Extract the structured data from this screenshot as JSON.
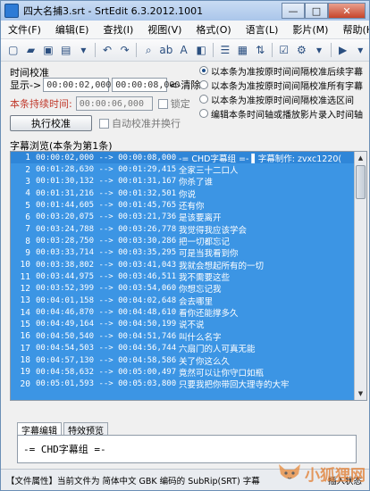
{
  "window": {
    "title": "四大名捕3.srt - SrtEdit 6.3.2012.1001",
    "minimize": "—",
    "maximize": "□",
    "close": "✕"
  },
  "menu": [
    "文件(F)",
    "编辑(E)",
    "查找(I)",
    "视图(V)",
    "格式(O)",
    "语言(L)",
    "影片(M)",
    "帮助(H)"
  ],
  "timing": {
    "group_title": "时间校准",
    "show_label": "显示->",
    "show_value": "00:00:02,000",
    "end_value": "00:00:08,000",
    "cancel_label": "<-清除",
    "lock_label": "锁定",
    "duration_label": "本条持续时间:",
    "duration_value": "00:00:06,000",
    "calibrate_button": "执行校准",
    "auto_label": "自动校准并换行",
    "options": [
      "以本条为准按原时间间隔校准后续字幕",
      "以本条为准按原时间间隔校准所有字幕",
      "以本条为准按原时间间隔校准选区间",
      "编辑本条时间轴或播放影片录入时间轴"
    ],
    "selected_option": 0
  },
  "list": {
    "title": "字幕浏览(本条为第1条)",
    "rows": [
      {
        "num": "1",
        "time": "00:00:02,000 --> 00:00:08,000",
        "text": "-= CHD字幕组 =- ▌字幕制作: zvxc1220("
      },
      {
        "num": "2",
        "time": "00:01:28,630 --> 00:01:29,415",
        "text": "全家三十二口人"
      },
      {
        "num": "3",
        "time": "00:01:30,132 --> 00:01:31,167",
        "text": "你杀了谁"
      },
      {
        "num": "4",
        "time": "00:01:31,216 --> 00:01:32,501",
        "text": "你说"
      },
      {
        "num": "5",
        "time": "00:01:44,605 --> 00:01:45,765",
        "text": "还有你"
      },
      {
        "num": "6",
        "time": "00:03:20,075 --> 00:03:21,736",
        "text": "是该要离开"
      },
      {
        "num": "7",
        "time": "00:03:24,788 --> 00:03:26,778",
        "text": "我觉得我应该学会"
      },
      {
        "num": "8",
        "time": "00:03:28,750 --> 00:03:30,286",
        "text": "把一切都忘记"
      },
      {
        "num": "9",
        "time": "00:03:33,714 --> 00:03:35,295",
        "text": "可是当我看到你"
      },
      {
        "num": "10",
        "time": "00:03:38,802 --> 00:03:41,043",
        "text": "我就会想起所有的一切"
      },
      {
        "num": "11",
        "time": "00:03:44,975 --> 00:03:46,511",
        "text": "我不需要这些"
      },
      {
        "num": "12",
        "time": "00:03:52,399 --> 00:03:54,060",
        "text": "你想忘记我"
      },
      {
        "num": "13",
        "time": "00:04:01,158 --> 00:04:02,648",
        "text": "会去哪里"
      },
      {
        "num": "14",
        "time": "00:04:46,870 --> 00:04:48,610",
        "text": "看你还能撑多久"
      },
      {
        "num": "15",
        "time": "00:04:49,164 --> 00:04:50,199",
        "text": "说不说"
      },
      {
        "num": "16",
        "time": "00:04:50,540 --> 00:04:51,746",
        "text": "叫什么名字"
      },
      {
        "num": "17",
        "time": "00:04:54,503 --> 00:04:56,744",
        "text": "六扇门的人可真无能"
      },
      {
        "num": "18",
        "time": "00:04:57,130 --> 00:04:58,586",
        "text": "关了你这么久"
      },
      {
        "num": "19",
        "time": "00:04:58,632 --> 00:05:00,497",
        "text": "竟然可以让你守口如瓶"
      },
      {
        "num": "20",
        "time": "00:05:01,593 --> 00:05:03,800",
        "text": "只要我把你带回大理寺的大牢"
      }
    ]
  },
  "tabs": [
    "字幕编辑",
    "特效预览"
  ],
  "editor": {
    "value": "-= CHD字幕组 =-"
  },
  "status": {
    "left": "【文件属性】当前文件为 简体中文 GBK 编码的 SubRip(SRT) 字幕",
    "right": "插入状态"
  },
  "watermark": {
    "text": "小狐狸网"
  }
}
